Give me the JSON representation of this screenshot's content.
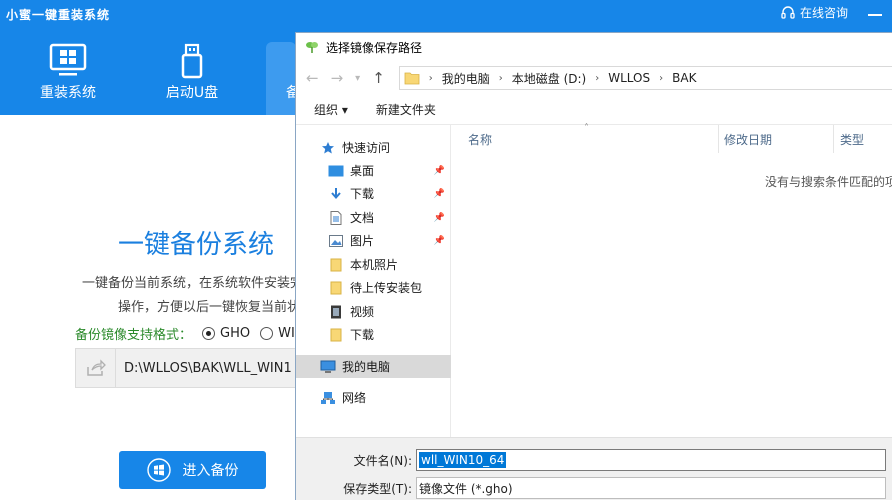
{
  "app": {
    "title": "小蜜一键重装系统",
    "consult_label": "在线咨询",
    "nav": [
      {
        "label": "重装系统",
        "icon": "monitor-icon"
      },
      {
        "label": "启动U盘",
        "icon": "usb-icon"
      },
      {
        "label": "备",
        "icon": "backup-icon"
      }
    ],
    "main_title": "一键备份系统",
    "desc_line1": "一键备份当前系统，在系统软件安装完",
    "desc_line2": "操作，方便以后一键恢复当前状",
    "format_label": "备份镜像支持格式：",
    "format_options": [
      "GHO",
      "WI"
    ],
    "path_value": "D:\\WLLOS\\BAK\\WLL_WIN1",
    "backup_button": "进入备份",
    "accent_color": "#1786e8"
  },
  "dialog": {
    "title": "选择镜像保存路径",
    "address": {
      "segments": [
        "我的电脑",
        "本地磁盘 (D:)",
        "WLLOS",
        "BAK"
      ]
    },
    "toolbar": {
      "organize": "组织 ▾",
      "new_folder": "新建文件夹"
    },
    "nav_pane": [
      {
        "label": "快速访问",
        "icon": "star-icon",
        "pinned": false
      },
      {
        "label": "桌面",
        "icon": "desktop-icon",
        "pinned": true
      },
      {
        "label": "下载",
        "icon": "download-icon",
        "pinned": true
      },
      {
        "label": "文档",
        "icon": "document-icon",
        "pinned": true
      },
      {
        "label": "图片",
        "icon": "picture-icon",
        "pinned": true
      },
      {
        "label": "本机照片",
        "icon": "folder-icon",
        "pinned": false
      },
      {
        "label": "待上传安装包",
        "icon": "folder-icon",
        "pinned": false
      },
      {
        "label": "视频",
        "icon": "video-icon",
        "pinned": false
      },
      {
        "label": "下载",
        "icon": "folder-icon",
        "pinned": false
      },
      {
        "label": "我的电脑",
        "icon": "computer-icon",
        "pinned": false
      },
      {
        "label": "网络",
        "icon": "network-icon",
        "pinned": false
      }
    ],
    "columns": [
      "名称",
      "修改日期",
      "类型"
    ],
    "empty_message": "没有与搜索条件匹配的项",
    "filename_label": "文件名(N):",
    "filename_value": "wll_WIN10_64",
    "filetype_label": "保存类型(T):",
    "filetype_value": "镜像文件 (*.gho)"
  }
}
